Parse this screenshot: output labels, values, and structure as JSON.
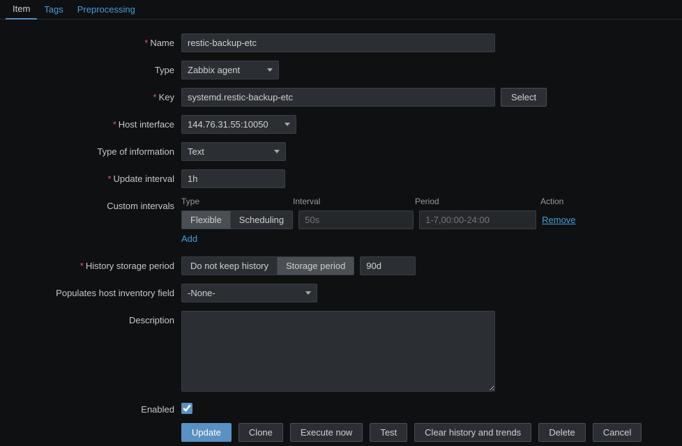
{
  "tabs": {
    "item": "Item",
    "tags": "Tags",
    "preprocessing": "Preprocessing"
  },
  "labels": {
    "name": "Name",
    "type": "Type",
    "key": "Key",
    "hostInterface": "Host interface",
    "typeInfo": "Type of information",
    "updateInterval": "Update interval",
    "customIntervals": "Custom intervals",
    "historyStorage": "History storage period",
    "populatesInventory": "Populates host inventory field",
    "description": "Description",
    "enabled": "Enabled"
  },
  "values": {
    "name": "restic-backup-etc",
    "type": "Zabbix agent",
    "key": "systemd.restic-backup-etc",
    "hostInterface": "144.76.31.55:10050",
    "typeInfo": "Text",
    "updateInterval": "1h",
    "historyValue": "90d",
    "inventory": "-None-",
    "description": "",
    "enabled": true
  },
  "customIntervals": {
    "headers": {
      "type": "Type",
      "interval": "Interval",
      "period": "Period",
      "action": "Action"
    },
    "flexible": "Flexible",
    "scheduling": "Scheduling",
    "intervalPlaceholder": "50s",
    "periodPlaceholder": "1-7,00:00-24:00",
    "remove": "Remove",
    "add": "Add"
  },
  "historyOptions": {
    "doNotKeep": "Do not keep history",
    "storagePeriod": "Storage period"
  },
  "buttons": {
    "select": "Select",
    "update": "Update",
    "clone": "Clone",
    "executeNow": "Execute now",
    "test": "Test",
    "clearHistory": "Clear history and trends",
    "delete": "Delete",
    "cancel": "Cancel"
  }
}
